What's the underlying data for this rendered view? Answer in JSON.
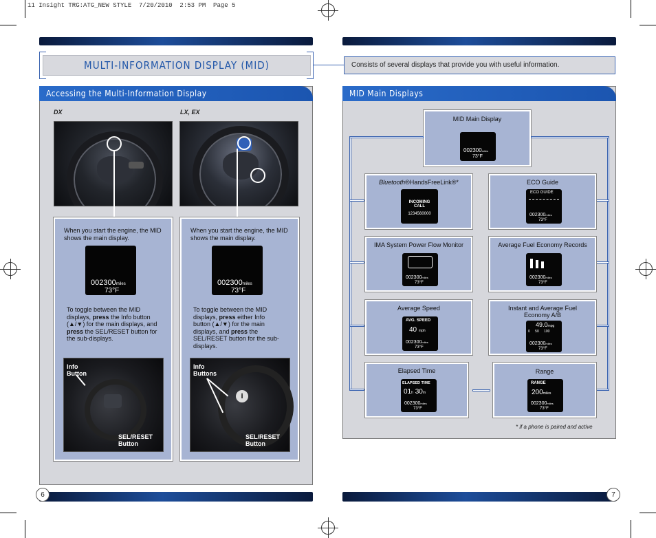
{
  "slug": "11 Insight TRG:ATG_NEW STYLE  7/20/2010  2:53 PM  Page 5",
  "left_page": {
    "title": "MULTI-INFORMATION DISPLAY (MID)",
    "section_tab": "Accessing the Multi-Information Display",
    "columns": [
      {
        "trim": "DX",
        "engine_text": "When you start the engine, the MID shows the main display.",
        "odometer": "002300",
        "odometer_unit": "miles",
        "temp": "73°F",
        "toggle_text_parts": [
          "To toggle between the MID displays, ",
          "press",
          " the Info button (▲/▼) for the main displays, and ",
          "press",
          " the SEL/RESET button for the sub-displays."
        ],
        "info_label": "Info\nButton",
        "sel_label": "SEL/RESET\nButton"
      },
      {
        "trim": "LX, EX",
        "engine_text": "When you start the engine, the MID shows the main display.",
        "odometer": "002300",
        "odometer_unit": "miles",
        "temp": "73°F",
        "toggle_text_parts": [
          "To toggle between the MID displays, ",
          "press",
          " either Info button (▲/▼) for the main displays, and ",
          "press",
          " the SEL/RESET button for the sub-displays."
        ],
        "info_label": "Info\nButtons",
        "sel_label": "SEL/RESET\nButton"
      }
    ],
    "page_number": "6"
  },
  "right_page": {
    "intro": "Consists of several displays that provide you with useful information.",
    "section_tab": "MID Main Displays",
    "main_display": {
      "title": "MID Main Display",
      "odo": "002300",
      "unit": "miles",
      "temp": "73°F"
    },
    "displays": [
      {
        "title_italic": "Bluetooth",
        "title_rest": "®HandsFreeLink®*",
        "screen": [
          "INCOMING",
          "CALL",
          "1234560000"
        ]
      },
      {
        "title": "ECO Guide",
        "screen": [
          "ECO GUIDE"
        ]
      },
      {
        "title": "IMA System Power Flow Monitor",
        "screen": []
      },
      {
        "title": "Average Fuel Economy Records",
        "screen": []
      },
      {
        "title": "Average Speed",
        "screen": [
          "AVG. SPEED",
          "40",
          "mph"
        ]
      },
      {
        "title": "Instant and Average Fuel Economy A/B",
        "screen": [
          "49.0",
          "mpg",
          "0",
          "50",
          "100"
        ]
      },
      {
        "title": "Elapsed Time",
        "screen": [
          "ELAPSED TIME",
          "01",
          "h",
          "30",
          "m"
        ]
      },
      {
        "title": "Range",
        "screen": [
          "RANGE",
          "200",
          "miles"
        ]
      }
    ],
    "mini_odo": "002300",
    "mini_unit": "miles",
    "mini_temp": "73°F",
    "footnote": "* if a phone is paired and active",
    "page_number": "7"
  }
}
